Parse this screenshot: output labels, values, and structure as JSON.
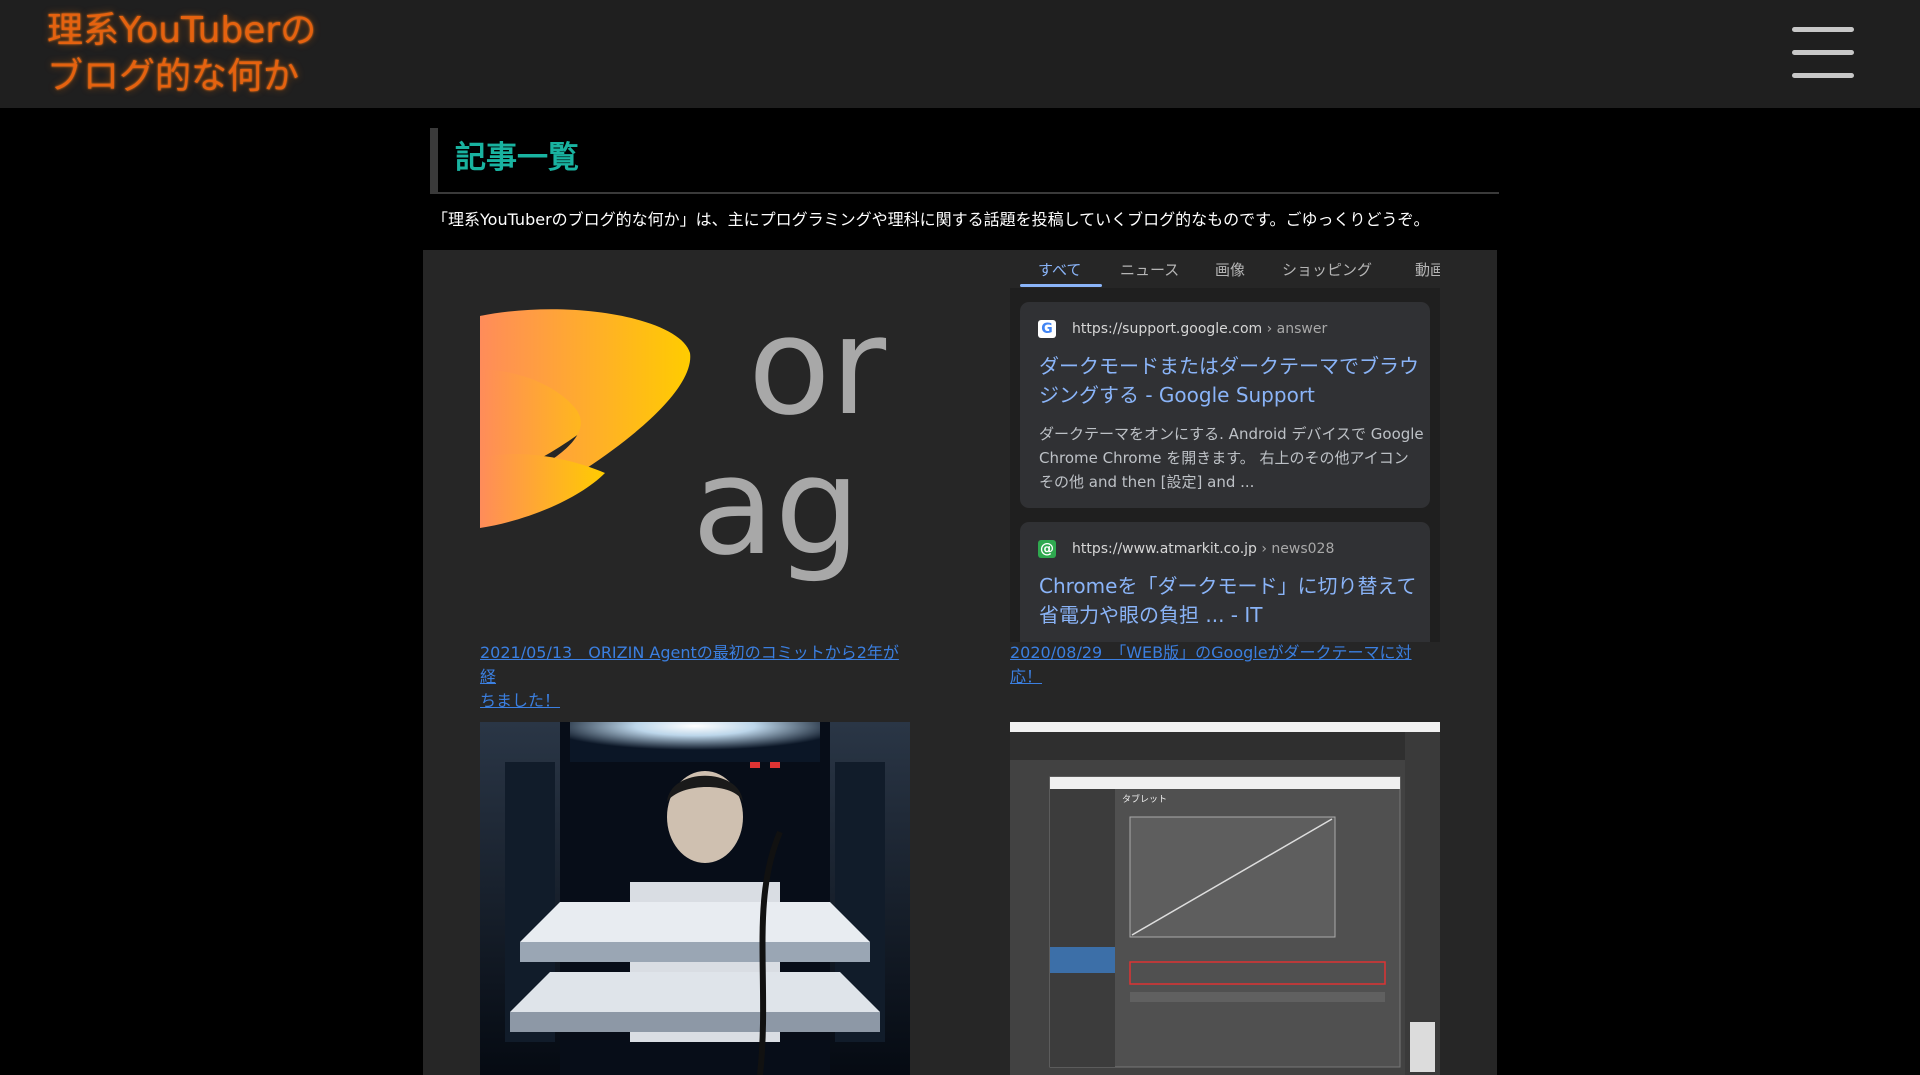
{
  "site": {
    "title_line1": "理系YouTuberの",
    "title_line2": "ブログ的な何か",
    "title_color": "#e5620f"
  },
  "menu": {
    "icon": "hamburger-menu-icon"
  },
  "heading": {
    "title": "記事一覧",
    "color": "#19b3a0"
  },
  "intro": "「理系YouTuberのブログ的な何か」は、主にプログラミングや理科に関する話題を投稿していくブログ的なものです。ごゆっくりどうぞ。",
  "articles": [
    {
      "link_line1": "2021/05/13　ORIZIN Agentの最初のコミットから2年が経",
      "link_line2": "ちました！",
      "thumb": {
        "logo_text_top": "or",
        "logo_text_bottom": "ag"
      }
    },
    {
      "link_line1": "2020/08/29　「WEB版」のGoogleがダークテーマに対",
      "link_line2": "応！",
      "thumb": {
        "tabs": [
          "すべて",
          "ニュース",
          "画像",
          "ショッピング",
          "動画"
        ],
        "results": [
          {
            "favicon": "G",
            "url": "https://support.google.com",
            "crumb": "› answer",
            "title": "ダークモードまたはダークテーマでブラウジングする - Google Support",
            "snippet": "ダークテーマをオンにする. Android デバイスで Google Chrome Chrome を開きます。 右上のその他アイコン その他 and then [設定] and ..."
          },
          {
            "favicon": "@",
            "url": "https://www.atmarkit.co.jp",
            "crumb": "› news028",
            "title": "Chromeを「ダークモード」に切り替えて省電力や眼の負担 ... - IT",
            "snippet": ""
          }
        ]
      }
    },
    {
      "link_line1": "",
      "link_line2": "",
      "thumb": {}
    },
    {
      "link_line1": "",
      "link_line2": "",
      "thumb": {
        "dialog_title": "タブレット"
      }
    }
  ],
  "colors": {
    "link": "#3b7fe0",
    "google_link": "#8ab4f8"
  }
}
